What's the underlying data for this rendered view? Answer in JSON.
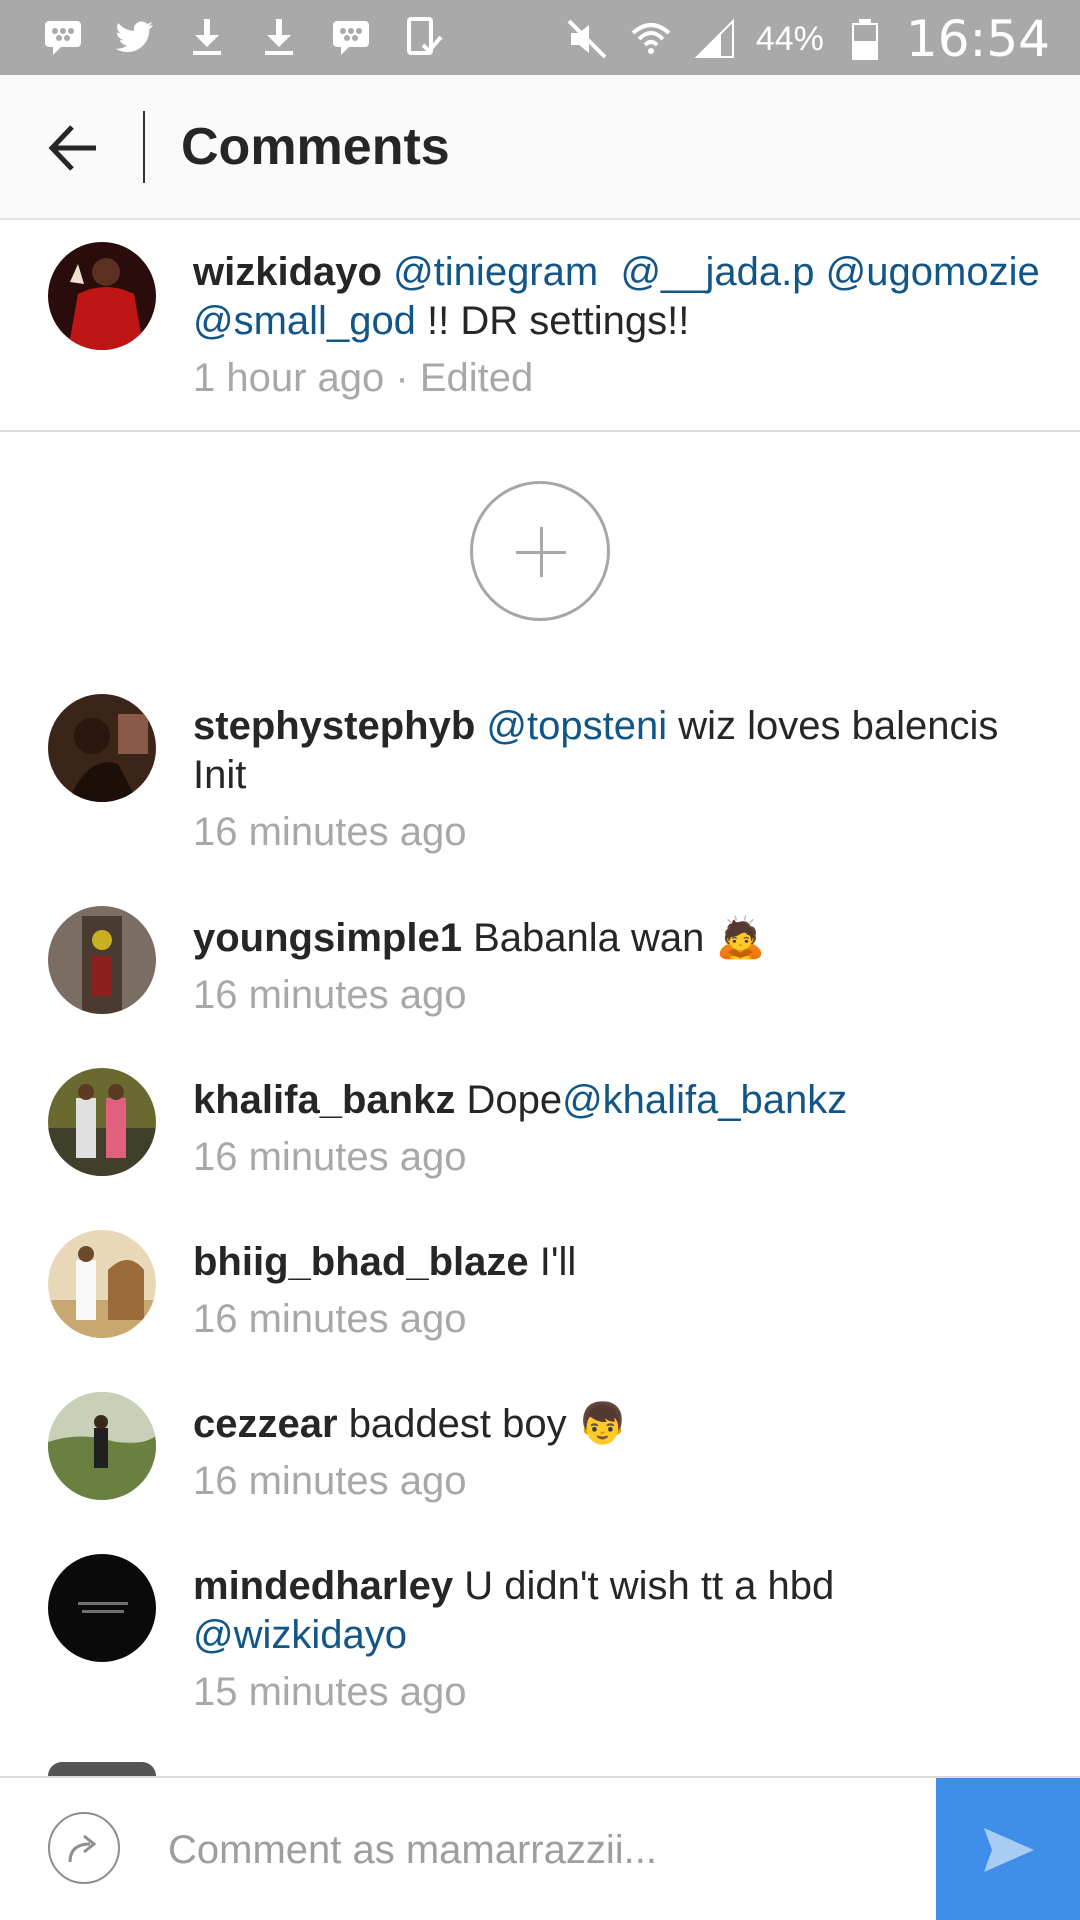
{
  "status_bar": {
    "left_icons": [
      "bbm-icon",
      "twitter-icon",
      "download-icon",
      "download-icon",
      "bbm-icon",
      "screenshot-icon"
    ],
    "right_icons": [
      "mute-icon",
      "wifi-icon",
      "signal-icon",
      "battery-icon"
    ],
    "battery": "44%",
    "time": "16:54"
  },
  "app_bar": {
    "title": "Comments"
  },
  "caption": {
    "username": "wizkidayo",
    "mention1": "@tiniegram",
    "mention2": "@__jada.p",
    "mention3": "@ugomozie",
    "mention4": "@small_god",
    "text_after": " !! DR settings!!",
    "time": "1 hour ago",
    "separator": " · ",
    "edited": "Edited"
  },
  "comments": [
    {
      "username": "stephystephyb",
      "mention": "@topsteni",
      "text": " wiz loves balencis Init",
      "time": "16 minutes ago"
    },
    {
      "username": "youngsimple1",
      "text": "Babanla wan 🙇",
      "time": "16 minutes ago"
    },
    {
      "username": "khalifa_bankz",
      "text": "Dope",
      "mention": "@khalifa_bankz",
      "time": "16 minutes ago"
    },
    {
      "username": "bhiig_bhad_blaze",
      "text": "I'll",
      "time": "16 minutes ago"
    },
    {
      "username": "cezzear",
      "text": "baddest boy 👦",
      "time": "16 minutes ago"
    },
    {
      "username": "mindedharley",
      "text": "U didn't wish tt a hbd ",
      "mention": "@wizkidayo",
      "time": "15 minutes ago"
    }
  ],
  "composer": {
    "placeholder": "Comment as mamarrazzii..."
  },
  "colors": {
    "mention": "#125688",
    "send": "#3f8ee9",
    "status_bar": "#a9a9a9",
    "meta": "#a8a8a8"
  }
}
